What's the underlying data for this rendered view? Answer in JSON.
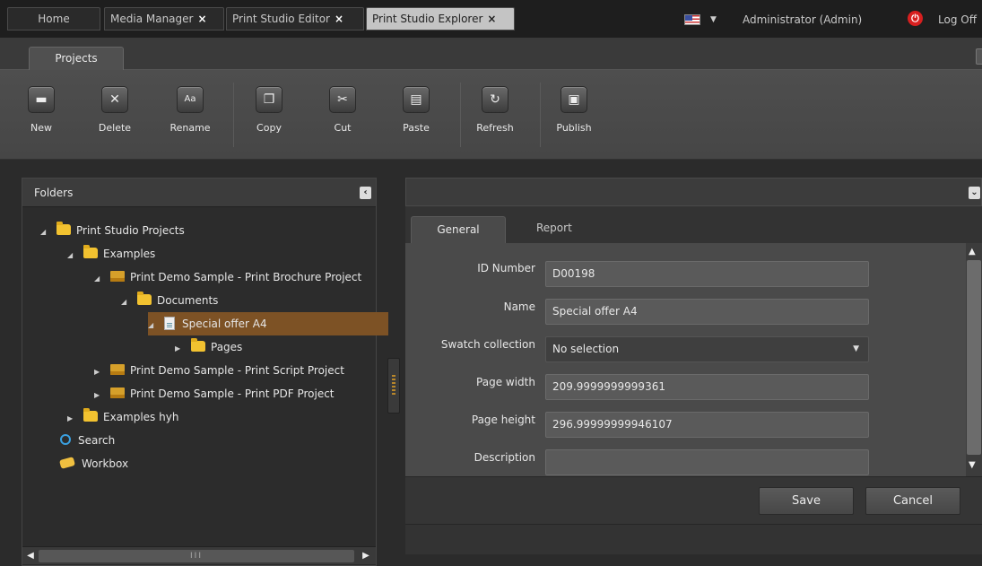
{
  "top_tabs": {
    "home": "Home",
    "media_manager": "Media Manager",
    "print_editor": "Print Studio Editor",
    "print_explorer": "Print Studio Explorer",
    "close": "×"
  },
  "user": {
    "name": "Administrator (Admin)",
    "logoff": "Log Off",
    "language_flag": "us-flag-icon"
  },
  "ribbon": {
    "tab": "Projects",
    "buttons": [
      {
        "label": "New",
        "icon": "new-icon"
      },
      {
        "label": "Delete",
        "icon": "delete-icon"
      },
      {
        "label": "Rename",
        "icon": "rename-icon"
      },
      {
        "label": "Copy",
        "icon": "copy-icon"
      },
      {
        "label": "Cut",
        "icon": "scissors-icon"
      },
      {
        "label": "Paste",
        "icon": "paste-icon"
      },
      {
        "label": "Refresh",
        "icon": "refresh-icon"
      },
      {
        "label": "Publish",
        "icon": "printer-icon"
      }
    ]
  },
  "folders": {
    "title": "Folders",
    "tree": [
      {
        "label": "Print Studio Projects",
        "icon": "folder-icon",
        "expanded": true
      },
      {
        "label": "Examples",
        "icon": "folder-icon",
        "expanded": true
      },
      {
        "label": "Print Demo Sample - Print Brochure Project",
        "icon": "project-icon",
        "expanded": true
      },
      {
        "label": "Documents",
        "icon": "folder-icon",
        "expanded": true
      },
      {
        "label": "Special offer A4",
        "icon": "document-icon",
        "expanded": true,
        "selected": true
      },
      {
        "label": "Pages",
        "icon": "folder-icon",
        "expanded": false
      },
      {
        "label": "Print Demo Sample - Print Script Project",
        "icon": "project-icon",
        "expanded": false
      },
      {
        "label": "Print Demo Sample - Print PDF Project",
        "icon": "project-icon",
        "expanded": false
      },
      {
        "label": "Examples hyh",
        "icon": "folder-icon",
        "expanded": false
      },
      {
        "label": "Search",
        "icon": "search-icon"
      },
      {
        "label": "Workbox",
        "icon": "workbox-icon"
      }
    ]
  },
  "details": {
    "tabs": [
      "General",
      "Report"
    ],
    "active_tab": "General",
    "fields": [
      {
        "label": "ID Number",
        "value": "D00198"
      },
      {
        "label": "Name",
        "value": "Special offer A4"
      },
      {
        "label": "Swatch collection",
        "value": "No selection"
      },
      {
        "label": "Page width",
        "value": "209.9999999999361"
      },
      {
        "label": "Page height",
        "value": "296.99999999946107"
      },
      {
        "label": "Description",
        "value": ""
      }
    ],
    "save_label": "Save",
    "cancel_label": "Cancel"
  },
  "colors": {
    "selection": "#7d5225",
    "power": "#d81f1f",
    "folder": "#f2c230"
  }
}
